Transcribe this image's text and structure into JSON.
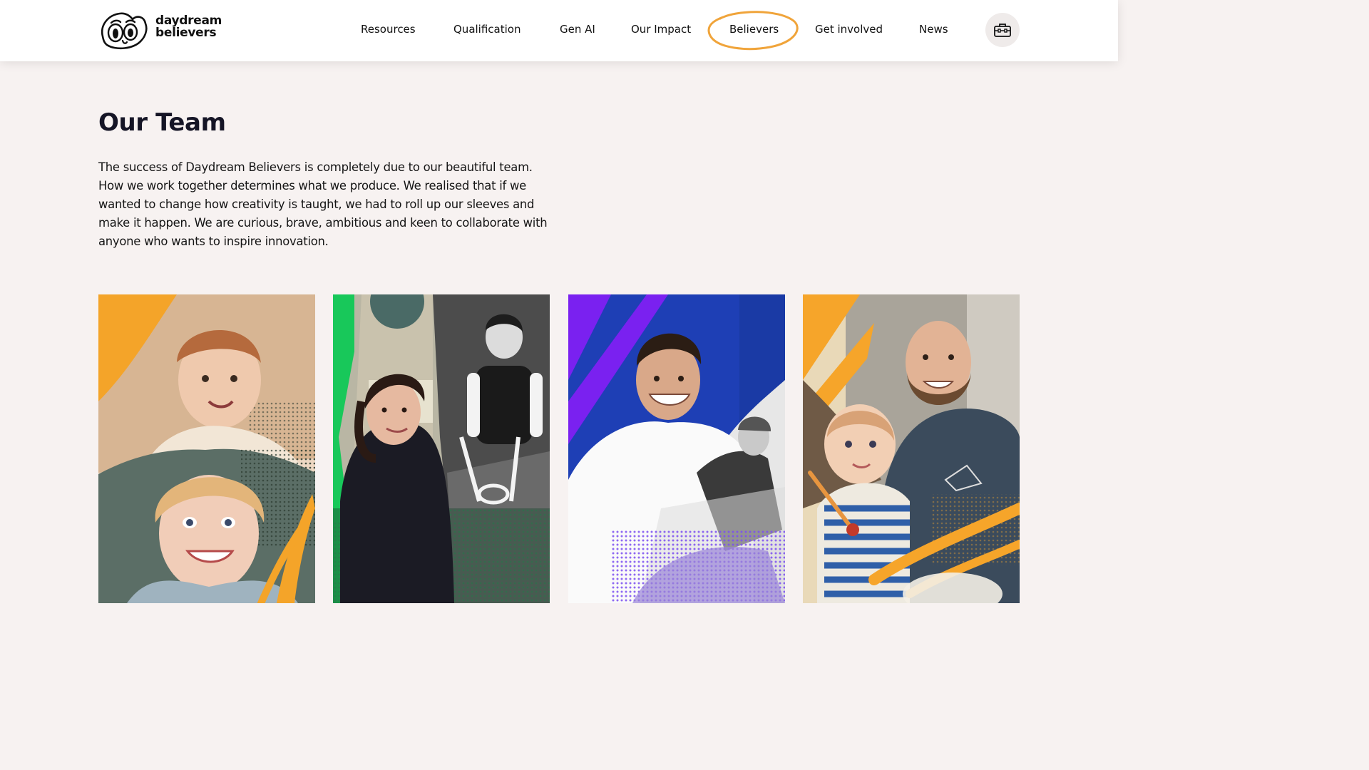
{
  "brand": {
    "line1": "daydream",
    "line2": "believers"
  },
  "nav": {
    "items": [
      {
        "label": "Resources"
      },
      {
        "label": "Qualification"
      },
      {
        "label": "Gen AI"
      },
      {
        "label": "Our Impact"
      },
      {
        "label": "Believers",
        "active": true
      },
      {
        "label": "Get involved"
      },
      {
        "label": "News"
      }
    ],
    "kit_icon": "toolbox-icon",
    "active_ring_color": "#f0a43a"
  },
  "page": {
    "title": "Our Team",
    "intro": "The success of Daydream Believers is completely due to our beautiful team. How we work together determines what we produce. We realised that if we wanted to change how creativity is taught, we had to roll up our sleeves and make it happen. We are curious, brave, ambitious and keen to collaborate with anyone who wants to inspire innovation."
  },
  "team": {
    "members": [
      {
        "accent": "#f6a52a",
        "photo": "team-member-1-photo"
      },
      {
        "accent": "#15c95c",
        "photo": "team-member-2-photo"
      },
      {
        "accent": "#7a21f0",
        "photo": "team-member-3-photo"
      },
      {
        "accent": "#f6a52a",
        "photo": "team-member-4-photo"
      }
    ]
  }
}
